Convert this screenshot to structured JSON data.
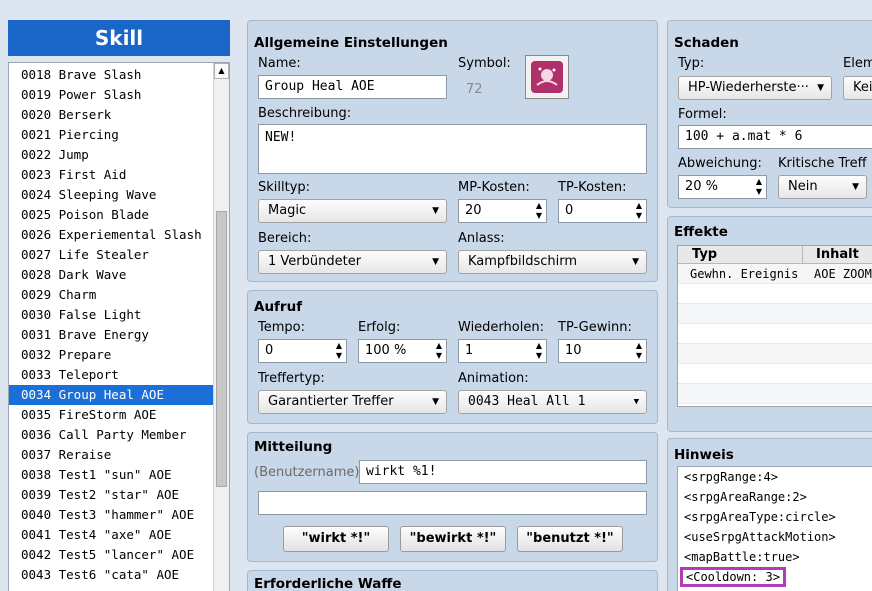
{
  "list": {
    "header": "Skill",
    "items": [
      {
        "label": "0018 Brave Slash"
      },
      {
        "label": "0019 Power Slash"
      },
      {
        "label": "0020 Berserk"
      },
      {
        "label": "0021 Piercing"
      },
      {
        "label": "0022 Jump"
      },
      {
        "label": "0023 First Aid"
      },
      {
        "label": "0024 Sleeping Wave"
      },
      {
        "label": "0025 Poison Blade"
      },
      {
        "label": "0026 Experiemental Slash"
      },
      {
        "label": "0027 Life Stealer"
      },
      {
        "label": "0028 Dark Wave"
      },
      {
        "label": "0029 Charm"
      },
      {
        "label": "0030 False Light"
      },
      {
        "label": "0031 Brave Energy"
      },
      {
        "label": "0032 Prepare"
      },
      {
        "label": "0033 Teleport"
      },
      {
        "label": "0034 Group Heal AOE",
        "selected": true
      },
      {
        "label": "0035 FireStorm AOE"
      },
      {
        "label": "0036 Call Party Member"
      },
      {
        "label": "0037 Reraise"
      },
      {
        "label": "0038 Test1 \"sun\" AOE"
      },
      {
        "label": "0039 Test2 \"star\" AOE"
      },
      {
        "label": "0040 Test3 \"hammer\" AOE"
      },
      {
        "label": "0041 Test4 \"axe\" AOE"
      },
      {
        "label": "0042 Test5 \"lancer\" AOE"
      },
      {
        "label": "0043 Test6 \"cata\" AOE"
      }
    ]
  },
  "allgemein": {
    "title": "Allgemeine Einstellungen",
    "name_label": "Name:",
    "name_value": "Group Heal AOE",
    "symbol_label": "Symbol:",
    "symbol_index": "72",
    "beschreibung_label": "Beschreibung:",
    "beschreibung_value": "NEW!",
    "skilltyp_label": "Skilltyp:",
    "skilltyp_value": "Magic",
    "mp_label": "MP-Kosten:",
    "mp_value": "20",
    "tp_label": "TP-Kosten:",
    "tp_value": "0",
    "bereich_label": "Bereich:",
    "bereich_value": "1 Verbündeter",
    "anlass_label": "Anlass:",
    "anlass_value": "Kampfbildschirm"
  },
  "aufruf": {
    "title": "Aufruf",
    "tempo_label": "Tempo:",
    "tempo_value": "0",
    "erfolg_label": "Erfolg:",
    "erfolg_value": "100 %",
    "wiederholen_label": "Wiederholen:",
    "wiederholen_value": "1",
    "tpgewinn_label": "TP-Gewinn:",
    "tpgewinn_value": "10",
    "treffertyp_label": "Treffertyp:",
    "treffertyp_value": "Garantierter Treffer",
    "animation_label": "Animation:",
    "animation_value": "0043 Heal All 1"
  },
  "mitteilung": {
    "title": "Mitteilung",
    "user_placeholder": "(Benutzername)",
    "line1_value": "wirkt %1!",
    "line2_value": "",
    "btn_wirkt": "\"wirkt *!\"",
    "btn_bewirkt": "\"bewirkt *!\"",
    "btn_benutzt": "\"benutzt *!\""
  },
  "waffe": {
    "title": "Erforderliche Waffe"
  },
  "schaden": {
    "title": "Schaden",
    "typ_label": "Typ:",
    "typ_value": "HP-Wiederherste···",
    "element_label": "Elem",
    "element_value": "Kei",
    "formel_label": "Formel:",
    "formel_value": "100 + a.mat * 6",
    "abweichung_label": "Abweichung:",
    "abweichung_value": "20 %",
    "kritisch_label": "Kritische Treff",
    "kritisch_value": "Nein"
  },
  "effekte": {
    "title": "Effekte",
    "col_typ": "Typ",
    "col_inhalt": "Inhalt",
    "rows": [
      {
        "typ": "Gewhn. Ereignis",
        "inhalt": "AOE ZOOM"
      },
      {
        "typ": "",
        "inhalt": ""
      },
      {
        "typ": "",
        "inhalt": ""
      },
      {
        "typ": "",
        "inhalt": ""
      },
      {
        "typ": "",
        "inhalt": ""
      },
      {
        "typ": "",
        "inhalt": ""
      },
      {
        "typ": "",
        "inhalt": ""
      }
    ]
  },
  "hinweis": {
    "title": "Hinweis",
    "lines": [
      "<srpgRange:4>",
      "<srpgAreaRange:2>",
      "<srpgAreaType:circle>",
      "<useSrpgAttackMotion>",
      "<mapBattle:true>",
      "<Cooldown: 3>"
    ],
    "highlight_color": "#b03cb8"
  },
  "colors": {
    "accent": "#1a66c8",
    "selection": "#1b6fd8",
    "panel": "#c9d8e8"
  }
}
